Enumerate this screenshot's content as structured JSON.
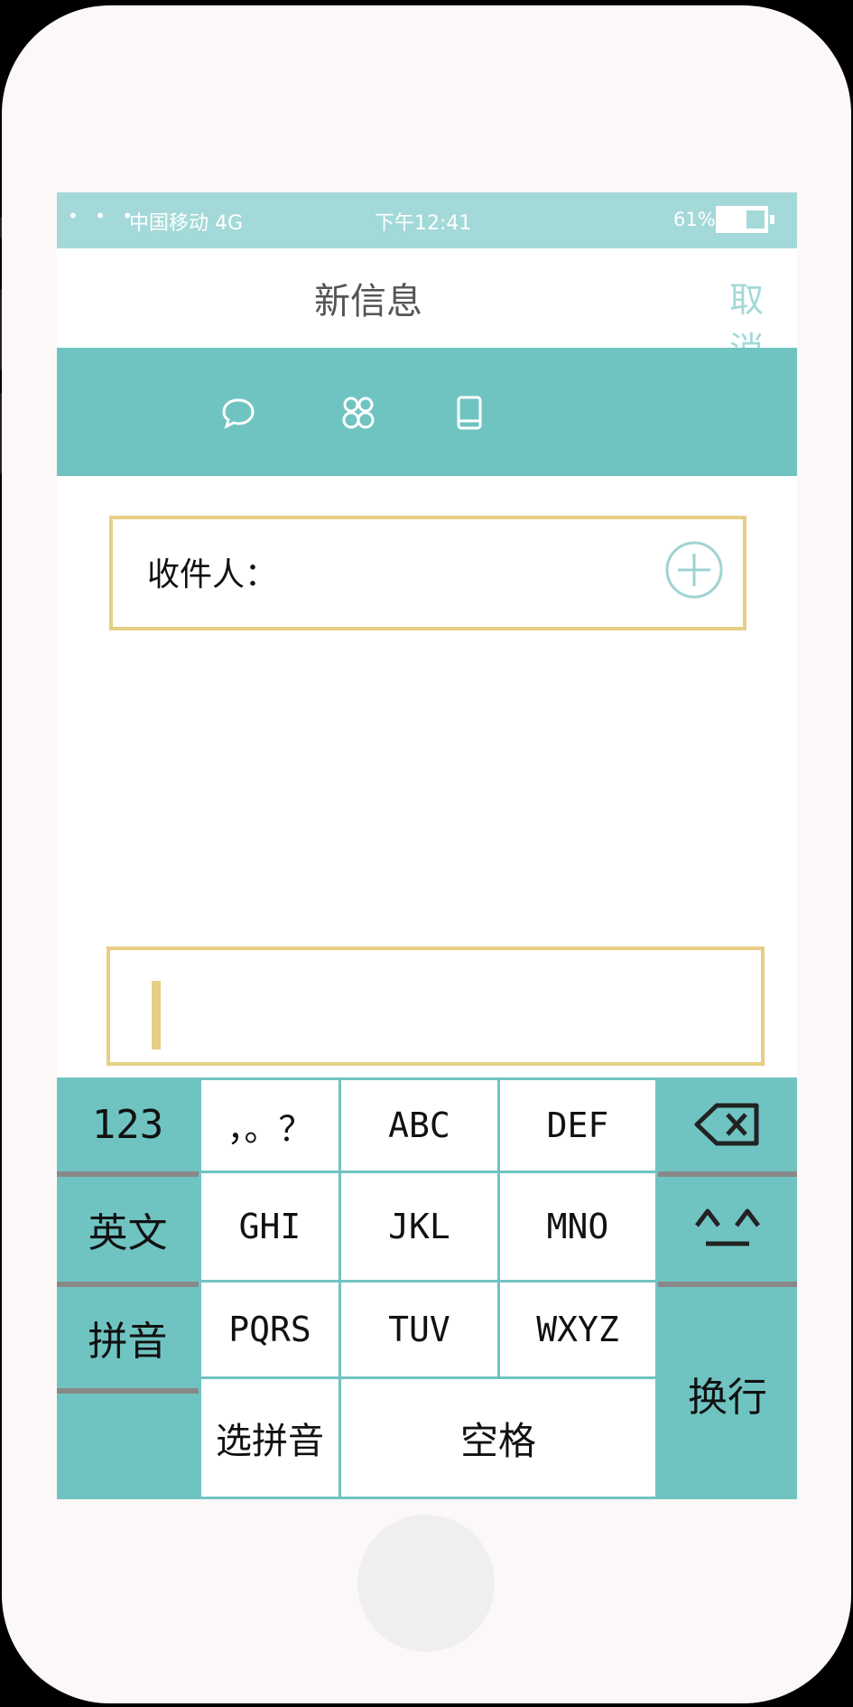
{
  "status_bar": {
    "signal_dots": "• • •",
    "carrier": "中国移动 4G",
    "time": "下午12:41",
    "battery_percent": "61%"
  },
  "nav": {
    "title": "新信息",
    "cancel_label": "取消"
  },
  "tabs": [
    {
      "icon": "message-bubble-icon"
    },
    {
      "icon": "group-icon"
    },
    {
      "icon": "phone-icon"
    }
  ],
  "recipient": {
    "label": "收件人：",
    "add_icon": "plus-circle-icon"
  },
  "keyboard": {
    "key_123": "123",
    "key_english": "英文",
    "key_pinyin": "拼音",
    "key_punct": "，。？",
    "key_abc": "ABC",
    "key_def": "DEF",
    "key_ghi": "GHI",
    "key_jkl": "JKL",
    "key_mno": "MNO",
    "key_pqrs": "PQRS",
    "key_tuv": "TUV",
    "key_wxyz": "WXYZ",
    "key_select_pinyin": "选拼音",
    "key_space": "空格",
    "key_enter": "换行",
    "backspace_icon": "backspace-icon",
    "emoji_icon": "smile-face-icon"
  },
  "colors": {
    "teal": "#6fc4c2",
    "status_teal": "#a3d9d8",
    "input_border": "#e6cf84"
  }
}
